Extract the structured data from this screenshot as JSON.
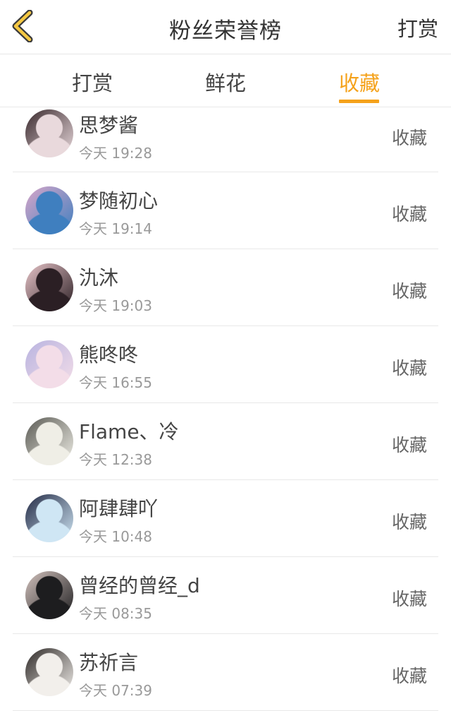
{
  "header": {
    "title": "粉丝荣誉榜",
    "action_label": "打赏",
    "back_icon": "chevron-left-icon",
    "accent_color": "#f5a21b"
  },
  "tabs": [
    {
      "label": "打赏",
      "active": false
    },
    {
      "label": "鲜花",
      "active": false
    },
    {
      "label": "收藏",
      "active": true
    }
  ],
  "fans": [
    {
      "name": "思梦酱",
      "time": "今天 19:28",
      "action": "收藏",
      "avatar_colors": [
        "#e9d9dc",
        "#3a2a2e"
      ]
    },
    {
      "name": "梦随初心",
      "time": "今天 19:14",
      "action": "收藏",
      "avatar_colors": [
        "#3f7fbf",
        "#d7a6c9"
      ]
    },
    {
      "name": "氿沐",
      "time": "今天 19:03",
      "action": "收藏",
      "avatar_colors": [
        "#2b1f24",
        "#e7c4c8"
      ]
    },
    {
      "name": "熊咚咚",
      "time": "今天 16:55",
      "action": "收藏",
      "avatar_colors": [
        "#f3dde8",
        "#b9b4e0"
      ]
    },
    {
      "name": "Flame、冷",
      "time": "今天 12:38",
      "action": "收藏",
      "avatar_colors": [
        "#efeee6",
        "#5b5b55"
      ]
    },
    {
      "name": "阿肆肆吖",
      "time": "今天 10:48",
      "action": "收藏",
      "avatar_colors": [
        "#cfe6f4",
        "#232a45"
      ]
    },
    {
      "name": "曾经的曾经_d",
      "time": "今天 08:35",
      "action": "收藏",
      "avatar_colors": [
        "#1d1d1f",
        "#d2c2bd"
      ]
    },
    {
      "name": "苏祈言",
      "time": "今天 07:39",
      "action": "收藏",
      "avatar_colors": [
        "#f2efeb",
        "#2f2a28"
      ]
    }
  ]
}
